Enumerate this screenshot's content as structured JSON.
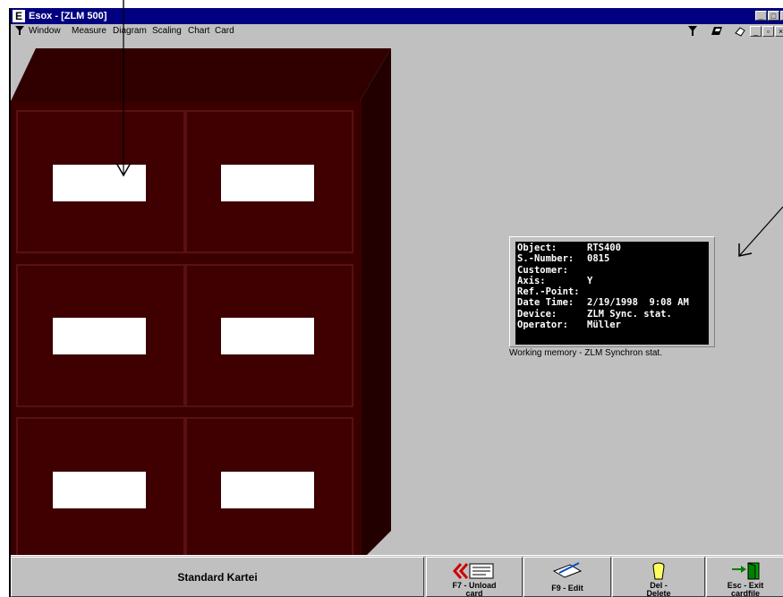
{
  "window": {
    "title": "Esox - [ZLM 500]",
    "app_icon_letter": "E",
    "controls": [
      "_",
      "□",
      "×"
    ]
  },
  "menubar": {
    "items": [
      "Window",
      "Measure",
      "Diagram",
      "Scaling",
      "Chart",
      "Card"
    ],
    "tool_icons": [
      "filter-icon",
      "eraser-icon",
      "hand-icon"
    ]
  },
  "cabinet": {
    "drawer_count": 6,
    "colors": {
      "front": "#3e0000",
      "side": "#230000",
      "top": "#300000",
      "label": "#ffffff"
    }
  },
  "info": {
    "rows": [
      {
        "label": "Object:",
        "value": "RTS400"
      },
      {
        "label": "S.-Number:",
        "value": "0815"
      },
      {
        "label": "Customer:",
        "value": ""
      },
      {
        "label": "Axis:",
        "value": "Y"
      },
      {
        "label": "Ref.-Point:",
        "value": ""
      },
      {
        "label": "Date Time:",
        "value": "2/19/1998  9:08 AM"
      },
      {
        "label": "Device:",
        "value": "ZLM Sync. stat."
      },
      {
        "label": "Operator:",
        "value": "Müller"
      }
    ],
    "caption": "Working memory - ZLM Synchron stat."
  },
  "statusbar": {
    "label": "Standard Kartei",
    "buttons": [
      {
        "line1": "F7 - Unload",
        "line2": "card",
        "icon": "unload-card-icon"
      },
      {
        "line1": "F9 - Edit",
        "line2": "",
        "icon": "edit-pen-icon"
      },
      {
        "line1": "Del -",
        "line2": "Delete",
        "icon": "trash-icon"
      },
      {
        "line1": "Esc - Exit",
        "line2": "cardfile",
        "icon": "exit-door-icon"
      }
    ]
  }
}
